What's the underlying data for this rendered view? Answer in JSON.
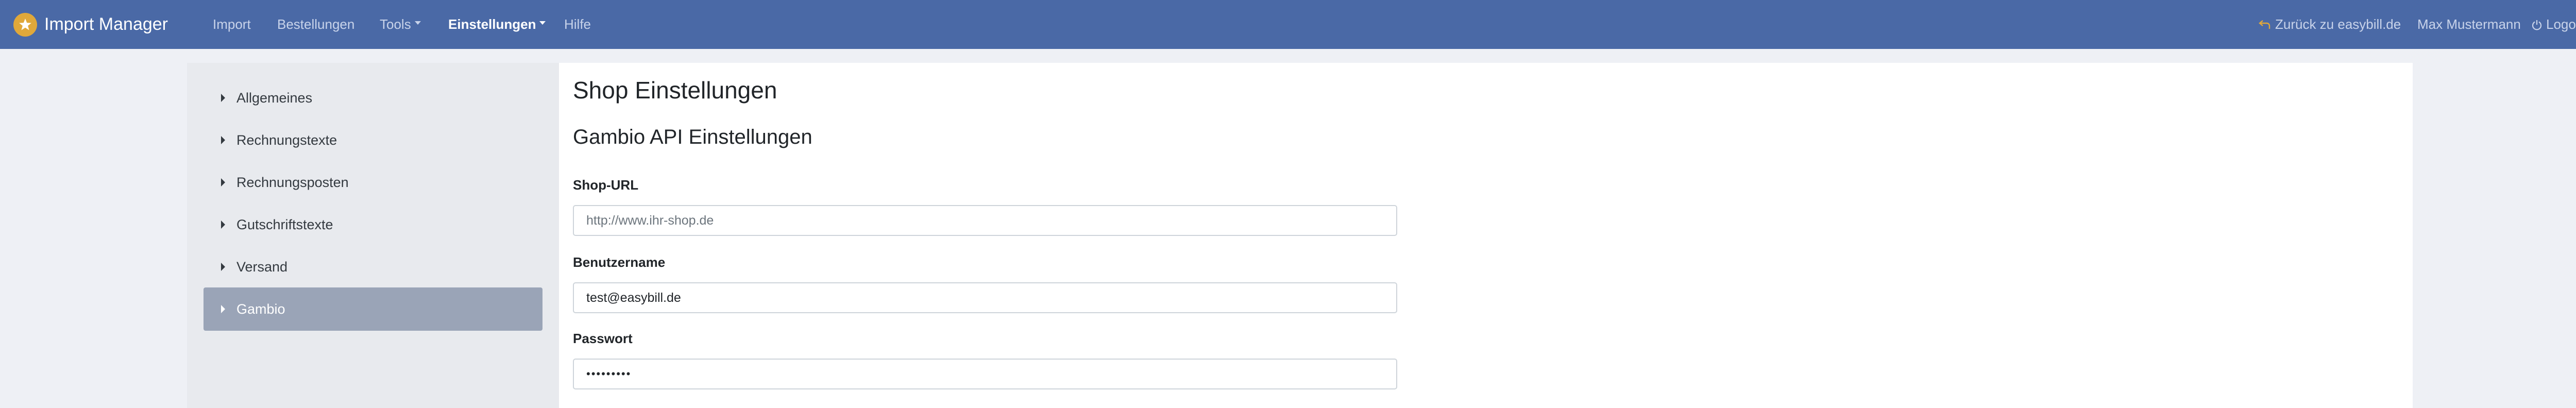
{
  "app": {
    "title": "Import Manager",
    "brand_color": "#4a69a6",
    "logo_icon": "star-badge-icon"
  },
  "nav": {
    "items": [
      {
        "label": "Import",
        "active": false
      },
      {
        "label": "Bestellungen",
        "active": false
      },
      {
        "label": "Tools",
        "active": false,
        "dropdown": true
      },
      {
        "label": "Einstellungen",
        "active": true,
        "dropdown": true
      },
      {
        "label": "Hilfe",
        "active": false
      }
    ],
    "right": {
      "back_label": "Zurück zu easybill.de",
      "back_icon": "return-arrow-icon",
      "user_label": "Max Mustermann",
      "logout_label": "Logout",
      "logout_icon": "power-icon"
    }
  },
  "sidebar": {
    "items": [
      {
        "label": "Allgemeines",
        "active": false
      },
      {
        "label": "Rechnungstexte",
        "active": false
      },
      {
        "label": "Rechnungsposten",
        "active": false
      },
      {
        "label": "Gutschriftstexte",
        "active": false
      },
      {
        "label": "Versand",
        "active": false
      },
      {
        "label": "Gambio",
        "active": true
      }
    ]
  },
  "main": {
    "page_title": "Shop Einstellungen",
    "section_title": "Gambio API Einstellungen",
    "fields": {
      "shop_url": {
        "label": "Shop-URL",
        "value": "",
        "placeholder": "http://www.ihr-shop.de"
      },
      "username": {
        "label": "Benutzername",
        "value": "test@easybill.de"
      },
      "password": {
        "label": "Passwort",
        "value": "•••••••••"
      }
    }
  }
}
